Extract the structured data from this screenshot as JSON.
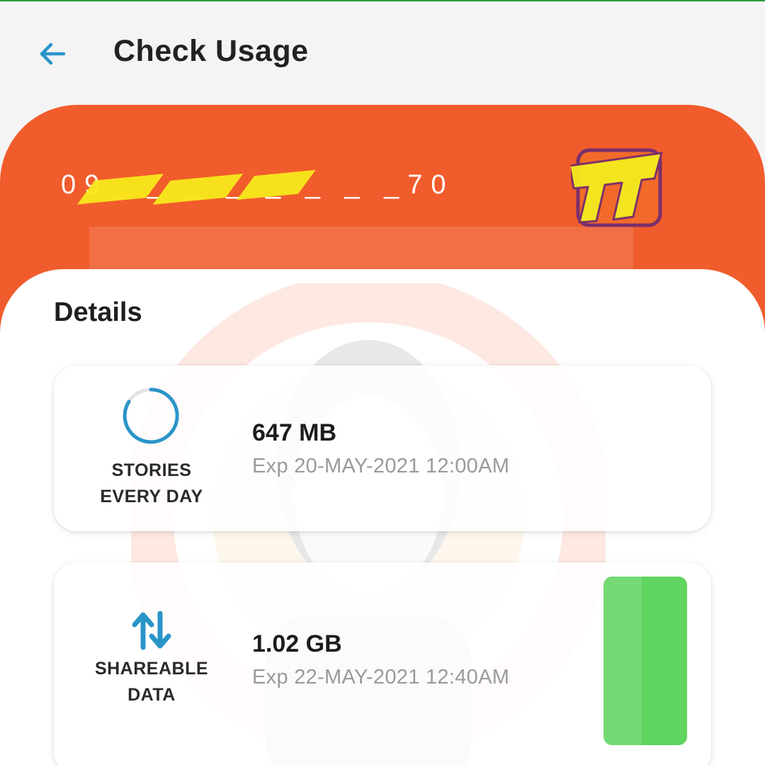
{
  "header": {
    "title": "Check Usage",
    "back_icon": "arrow-left-icon"
  },
  "account": {
    "number_display": "09_ _ _ _ _ _ _ _70",
    "brand_logo": "TNT",
    "brand_color": "#f15c2c",
    "logo_color": "#f3ea1f"
  },
  "details": {
    "heading": "Details",
    "items": [
      {
        "icon": "circular-progress-icon",
        "label_line1": "STORIES",
        "label_line2": "EVERY DAY",
        "amount": "647 MB",
        "expiry": "Exp 20-MAY-2021 12:00AM"
      },
      {
        "icon": "data-transfer-arrows-icon",
        "label_line1": "SHAREABLE",
        "label_line2": "DATA",
        "amount": "1.02 GB",
        "expiry": "Exp 22-MAY-2021 12:40AM",
        "level_color": "#5fd45f"
      }
    ]
  },
  "colors": {
    "accent_blue": "#2a95c9",
    "text_dark": "#1c1c1c",
    "text_muted": "#9a9a9a"
  }
}
